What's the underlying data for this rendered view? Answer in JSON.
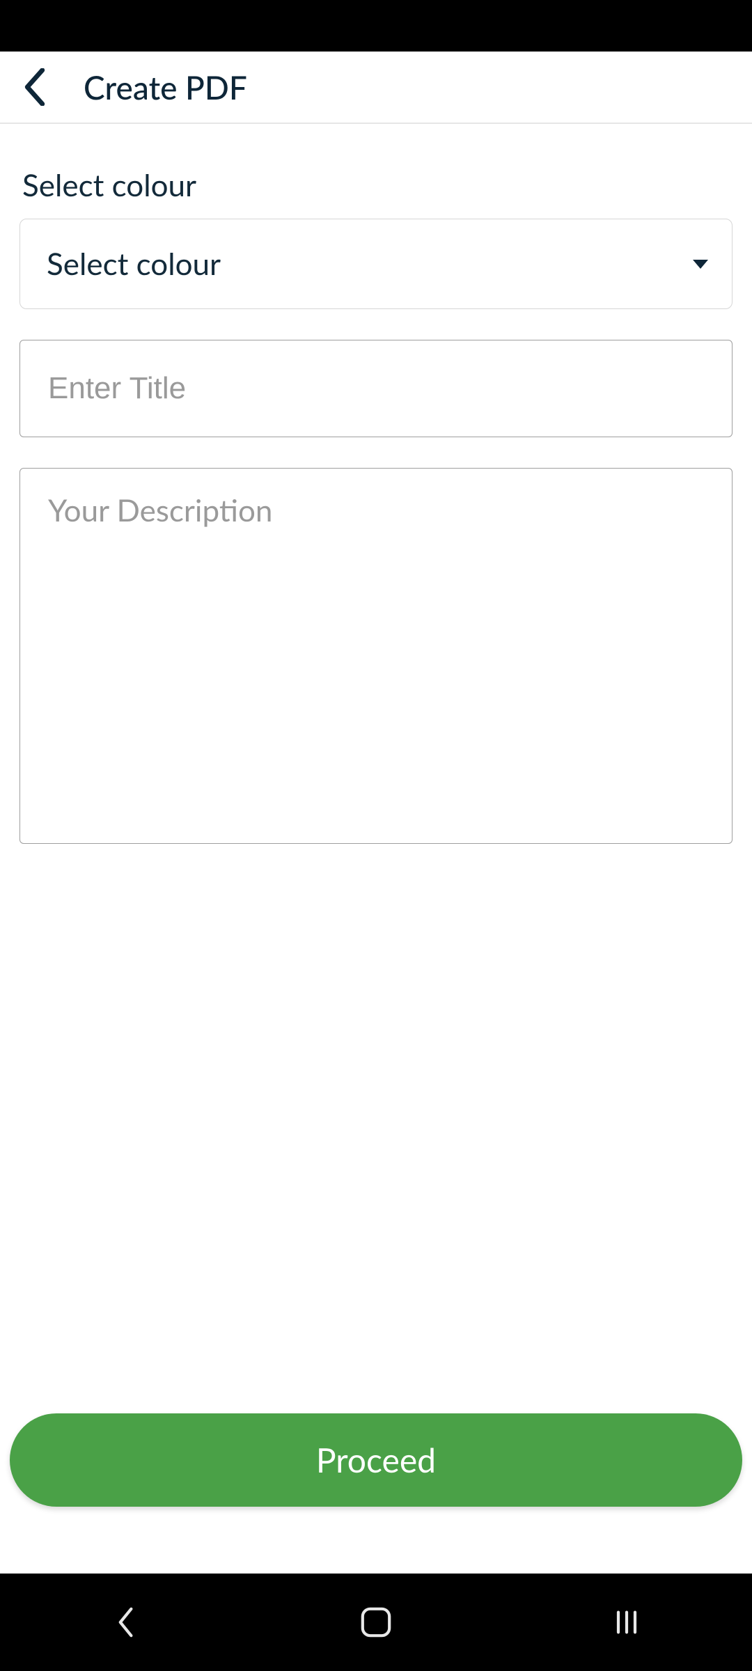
{
  "header": {
    "title": "Create PDF"
  },
  "form": {
    "colour_label": "Select colour",
    "colour_select_placeholder": "Select colour",
    "title_placeholder": "Enter Title",
    "description_placeholder": "Your Description"
  },
  "actions": {
    "proceed_label": "Proceed"
  }
}
